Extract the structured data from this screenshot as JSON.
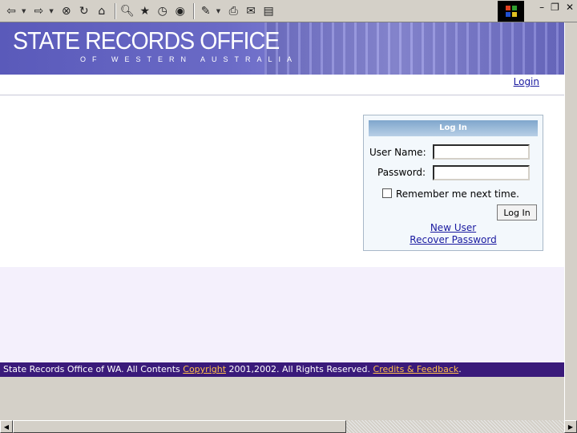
{
  "toolbar": {
    "icons": [
      "back-icon",
      "forward-icon",
      "stop-icon",
      "refresh-icon",
      "home-icon",
      "search-icon",
      "favorites-icon",
      "history-icon",
      "media-icon",
      "edit-icon",
      "print-icon",
      "mail-icon",
      "page-icon"
    ]
  },
  "window_controls": {
    "minimize": "–",
    "restore": "❐",
    "close": "✕"
  },
  "banner": {
    "title": "STATE RECORDS OFFICE",
    "subtitle": "OF WESTERN AUSTRALIA"
  },
  "nav": {
    "login": "Login"
  },
  "login_form": {
    "header": "Log In",
    "username_label": "User Name:",
    "username_value": "",
    "password_label": "Password:",
    "password_value": "",
    "remember_label": "Remember me next time.",
    "remember_checked": false,
    "submit_label": "Log In",
    "new_user_link": "New User",
    "recover_link": "Recover Password"
  },
  "footer": {
    "text_before": "State Records Office of WA. All Contents ",
    "copyright_link": "Copyright",
    "text_middle": " 2001,2002. All Rights Reserved. ",
    "credits_link": "Credits & Feedback",
    "text_after": "."
  },
  "colors": {
    "banner": "#6a6ac6",
    "footer": "#3a1a7a",
    "link": "#1a1aa0",
    "footer_link": "#ffc04a"
  }
}
